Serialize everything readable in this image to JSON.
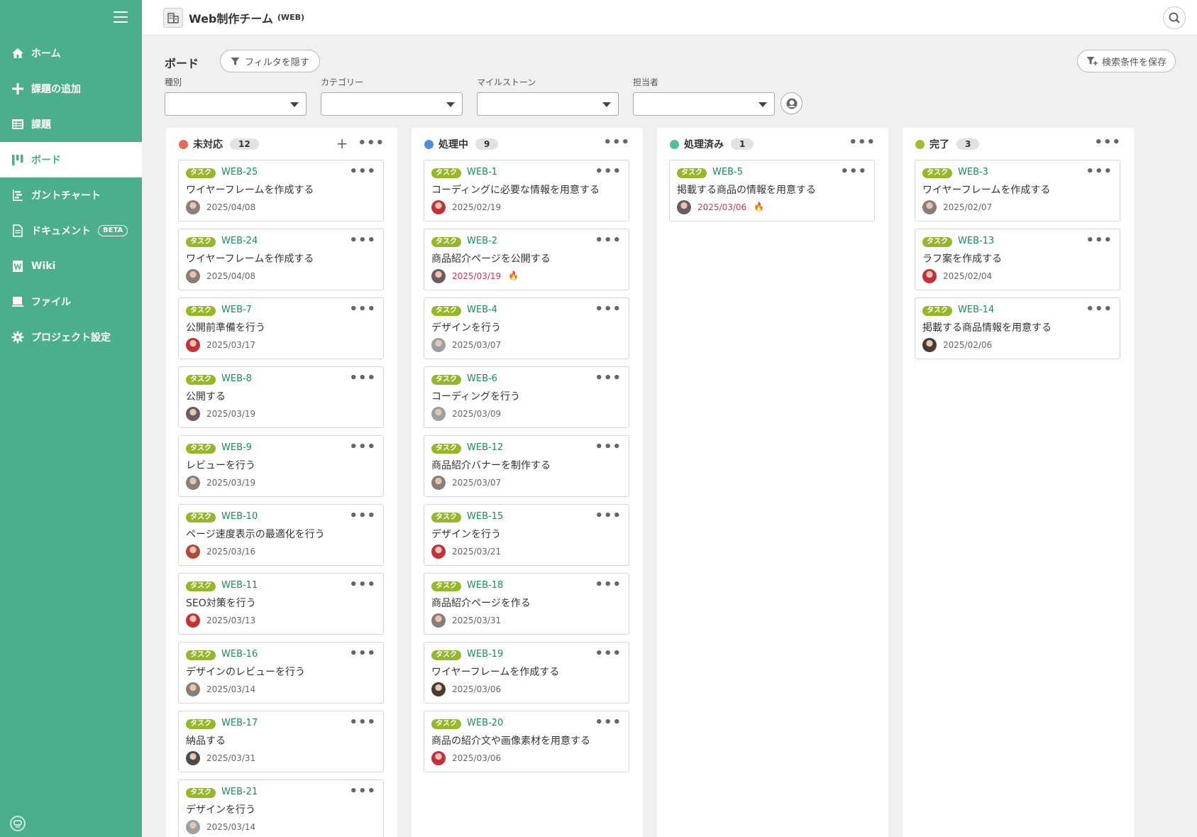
{
  "header": {
    "title": "Web制作チーム",
    "key": "(WEB)"
  },
  "sidebar": {
    "items": [
      {
        "label": "ホーム",
        "icon": "home-icon"
      },
      {
        "label": "課題の追加",
        "icon": "plus-icon"
      },
      {
        "label": "課題",
        "icon": "list-icon"
      },
      {
        "label": "ボード",
        "icon": "board-icon",
        "active": true
      },
      {
        "label": "ガントチャート",
        "icon": "gantt-icon"
      },
      {
        "label": "ドキュメント",
        "icon": "document-icon",
        "badge": "BETA"
      },
      {
        "label": "Wiki",
        "icon": "wiki-icon"
      },
      {
        "label": "ファイル",
        "icon": "folder-icon"
      },
      {
        "label": "プロジェクト設定",
        "icon": "gear-icon"
      }
    ]
  },
  "board": {
    "title": "ボード",
    "filter_toggle": "フィルタを隠す",
    "save_search": "検索条件を保存",
    "filters": [
      {
        "label": "種別",
        "value": ""
      },
      {
        "label": "カテゴリー",
        "value": ""
      },
      {
        "label": "マイルストーン",
        "value": ""
      },
      {
        "label": "担当者",
        "value": ""
      }
    ]
  },
  "colors": {
    "accent": "#4caf8c",
    "key": "#1a8a66",
    "task_badge": "#97b72a",
    "overdue": "#d63459"
  },
  "columns": [
    {
      "name": "未対応",
      "count": "12",
      "color": "#e8665e",
      "cards": [
        {
          "type": "タスク",
          "key": "WEB-25",
          "summary": "ワイヤーフレームを作成する",
          "due": "2025/04/08",
          "avatar": "#8a7f78"
        },
        {
          "type": "タスク",
          "key": "WEB-24",
          "summary": "ワイヤーフレームを作成する",
          "due": "2025/04/08",
          "avatar": "#8a7f78"
        },
        {
          "type": "タスク",
          "key": "WEB-7",
          "summary": "公開前準備を行う",
          "due": "2025/03/17",
          "avatar": "#c2313c"
        },
        {
          "type": "タスク",
          "key": "WEB-8",
          "summary": "公開する",
          "due": "2025/03/19",
          "avatar": "#6c5b62"
        },
        {
          "type": "タスク",
          "key": "WEB-9",
          "summary": "レビューを行う",
          "due": "2025/03/19",
          "avatar": "#8a7f78"
        },
        {
          "type": "タスク",
          "key": "WEB-10",
          "summary": "ページ速度表示の最適化を行う",
          "due": "2025/03/16",
          "avatar": "#b04a3e"
        },
        {
          "type": "タスク",
          "key": "WEB-11",
          "summary": "SEO対策を行う",
          "due": "2025/03/13",
          "avatar": "#c2313c"
        },
        {
          "type": "タスク",
          "key": "WEB-16",
          "summary": "デザインのレビューを行う",
          "due": "2025/03/14",
          "avatar": "#8a7f78"
        },
        {
          "type": "タスク",
          "key": "WEB-17",
          "summary": "納品する",
          "due": "2025/03/31",
          "avatar": "#4a4a4a"
        },
        {
          "type": "タスク",
          "key": "WEB-21",
          "summary": "デザインを行う",
          "due": "2025/03/14",
          "avatar": "#9aa0a8"
        }
      ]
    },
    {
      "name": "処理中",
      "count": "9",
      "color": "#4a8fdc",
      "cards": [
        {
          "type": "タスク",
          "key": "WEB-1",
          "summary": "コーディングに必要な情報を用意する",
          "due": "2025/02/19",
          "avatar": "#c2313c"
        },
        {
          "type": "タスク",
          "key": "WEB-2",
          "summary": "商品紹介ページを公開する",
          "due": "2025/03/19",
          "overdue": true,
          "avatar": "#6c5b62"
        },
        {
          "type": "タスク",
          "key": "WEB-4",
          "summary": "デザインを行う",
          "due": "2025/03/07",
          "avatar": "#9aa0a8"
        },
        {
          "type": "タスク",
          "key": "WEB-6",
          "summary": "コーディングを行う",
          "due": "2025/03/09",
          "avatar": "#9aa0a8"
        },
        {
          "type": "タスク",
          "key": "WEB-12",
          "summary": "商品紹介バナーを制作する",
          "due": "2025/03/07",
          "avatar": "#8a7f78"
        },
        {
          "type": "タスク",
          "key": "WEB-15",
          "summary": "デザインを行う",
          "due": "2025/03/21",
          "avatar": "#c2313c"
        },
        {
          "type": "タスク",
          "key": "WEB-18",
          "summary": "商品紹介ページを作る",
          "due": "2025/03/31",
          "avatar": "#8a7f78"
        },
        {
          "type": "タスク",
          "key": "WEB-19",
          "summary": "ワイヤーフレームを作成する",
          "due": "2025/03/06",
          "avatar": "#4a3a30"
        },
        {
          "type": "タスク",
          "key": "WEB-20",
          "summary": "商品の紹介文や画像素材を用意する",
          "due": "2025/03/06",
          "avatar": "#c2313c"
        }
      ]
    },
    {
      "name": "処理済み",
      "count": "1",
      "color": "#4fbf9f",
      "cards": [
        {
          "type": "タスク",
          "key": "WEB-5",
          "summary": "掲載する商品の情報を用意する",
          "due": "2025/03/06",
          "overdue": true,
          "avatar": "#6c5b62"
        }
      ]
    },
    {
      "name": "完了",
      "count": "3",
      "color": "#a0c034",
      "cards": [
        {
          "type": "タスク",
          "key": "WEB-3",
          "summary": "ワイヤーフレームを作成する",
          "due": "2025/02/07",
          "avatar": "#8a7f78"
        },
        {
          "type": "タスク",
          "key": "WEB-13",
          "summary": "ラフ案を作成する",
          "due": "2025/02/04",
          "avatar": "#c2313c"
        },
        {
          "type": "タスク",
          "key": "WEB-14",
          "summary": "掲載する商品情報を用意する",
          "due": "2025/02/06",
          "avatar": "#4a3a30"
        }
      ]
    }
  ]
}
